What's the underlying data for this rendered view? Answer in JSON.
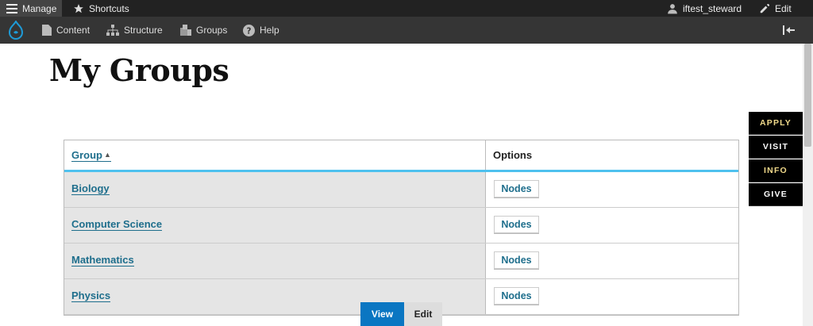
{
  "admin_bar": {
    "manage_label": "Manage",
    "shortcuts_label": "Shortcuts",
    "user_label": "iftest_steward",
    "edit_label": "Edit"
  },
  "toolbar": {
    "items": [
      {
        "label": "Content"
      },
      {
        "label": "Structure"
      },
      {
        "label": "Groups"
      },
      {
        "label": "Help"
      }
    ]
  },
  "page": {
    "title": "My Groups"
  },
  "side_buttons": [
    "APPLY",
    "VISIT",
    "INFO",
    "GIVE"
  ],
  "table": {
    "headers": {
      "group": "Group",
      "options": "Options"
    },
    "sort_indicator": "▲",
    "rows": [
      {
        "name": "Biology",
        "action": "Nodes"
      },
      {
        "name": "Computer Science",
        "action": "Nodes"
      },
      {
        "name": "Mathematics",
        "action": "Nodes"
      },
      {
        "name": "Physics",
        "action": "Nodes"
      }
    ]
  },
  "tabs": {
    "view": "View",
    "edit": "Edit",
    "active": "view"
  },
  "colors": {
    "admin_bar": "#222222",
    "toolbar": "#353535",
    "link": "#1e6e8c",
    "header_accent": "#4ec1ee",
    "active_tab": "#0a76c2",
    "side_button": "#000000",
    "side_button_gold": "#f0d98a"
  }
}
